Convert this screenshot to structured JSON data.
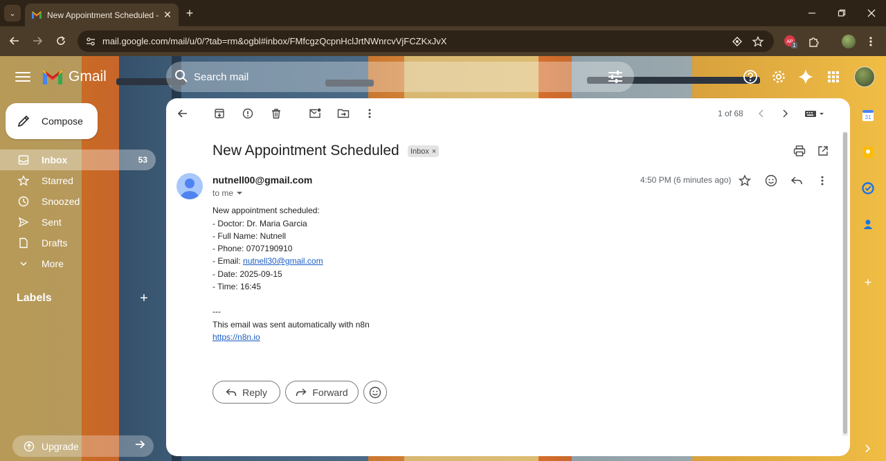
{
  "browser": {
    "tab_title": "New Appointment Scheduled -",
    "url": "mail.google.com/mail/u/0/?tab=rm&ogbl#inbox/FMfcgzQcpnHclJrtNWnrcvVjFCZKxJvX",
    "extension_badge": "1",
    "icons": [
      "tab-search-icon",
      "gmail-favicon",
      "close-tab-icon",
      "new-tab-icon",
      "minimize-icon",
      "restore-icon",
      "close-window-icon",
      "back-icon",
      "forward-icon",
      "reload-icon",
      "site-info-icon",
      "tracking-icon",
      "bookmark-star-icon",
      "extension-icon",
      "puzzle-icon",
      "profile-avatar"
    ]
  },
  "gmail": {
    "brand": "Gmail",
    "search_placeholder": "Search mail",
    "compose_label": "Compose",
    "nav": [
      {
        "label": "Inbox",
        "count": "53",
        "icon": "inbox-icon",
        "active": true
      },
      {
        "label": "Starred",
        "icon": "star-icon"
      },
      {
        "label": "Snoozed",
        "icon": "clock-icon"
      },
      {
        "label": "Sent",
        "icon": "send-icon"
      },
      {
        "label": "Drafts",
        "icon": "draft-icon"
      },
      {
        "label": "More",
        "icon": "chevron-down-icon"
      }
    ],
    "labels_title": "Labels",
    "upgrade_label": "Upgrade"
  },
  "message": {
    "pager": "1 of 68",
    "subject": "New Appointment Scheduled",
    "label_chip": "Inbox",
    "label_chip_close": "×",
    "sender": "nutnell00@gmail.com",
    "to": "to me",
    "time": "4:50 PM (6 minutes ago)",
    "body": {
      "line1": "New appointment scheduled:",
      "doctor": "- Doctor: Dr. Maria Garcia",
      "name": "- Full Name: Nutnell",
      "phone": "- Phone: 0707190910",
      "email_prefix": "- Email: ",
      "email_link": "nutnell30@gmail.com",
      "date": "- Date: 2025-09-15",
      "time": "- Time: 16:45",
      "separator": "---",
      "footer": "This email was sent automatically with n8n",
      "footer_link": "https://n8n.io"
    },
    "reply_label": "Reply",
    "forward_label": "Forward"
  },
  "colors": {
    "accent_blue": "#1a5ec2",
    "gmail_red": "#ea4335",
    "panel_bg": "#ffffff"
  }
}
